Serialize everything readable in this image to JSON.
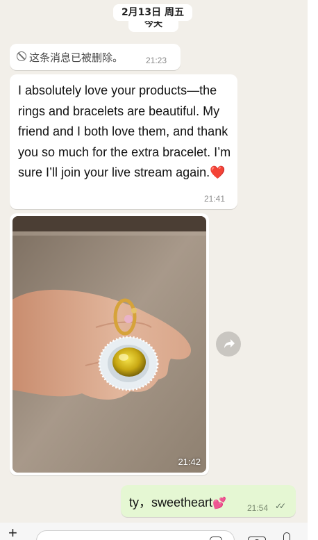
{
  "date_header": "2月13日 周五",
  "today_label": "今天",
  "messages": {
    "deleted": {
      "text": "这条消息已被删除。",
      "time": "21:23"
    },
    "incoming_text": {
      "text": "I absolutely love your products—the rings and bracelets are beautiful. My friend and I both love them, and thank you so much for the extra bracelet. I’m sure I’ll join your live stream again.",
      "emoji": "❤️",
      "time": "21:41"
    },
    "incoming_image": {
      "time": "21:42"
    },
    "outgoing": {
      "text": "ty，sweetheart",
      "emoji": "💕",
      "time": "21:54",
      "status": "read"
    }
  },
  "composer": {
    "placeholder": ""
  },
  "icons": {
    "deleted": "ban-icon",
    "forward": "forward-icon",
    "attach": "plus-icon",
    "sticker": "sticker-icon",
    "camera": "camera-icon",
    "mic": "mic-icon",
    "read_receipt": "double-check-icon"
  },
  "colors": {
    "chat_background": "#f2efe9",
    "incoming_bubble": "#ffffff",
    "outgoing_bubble": "#e5f7d3"
  }
}
